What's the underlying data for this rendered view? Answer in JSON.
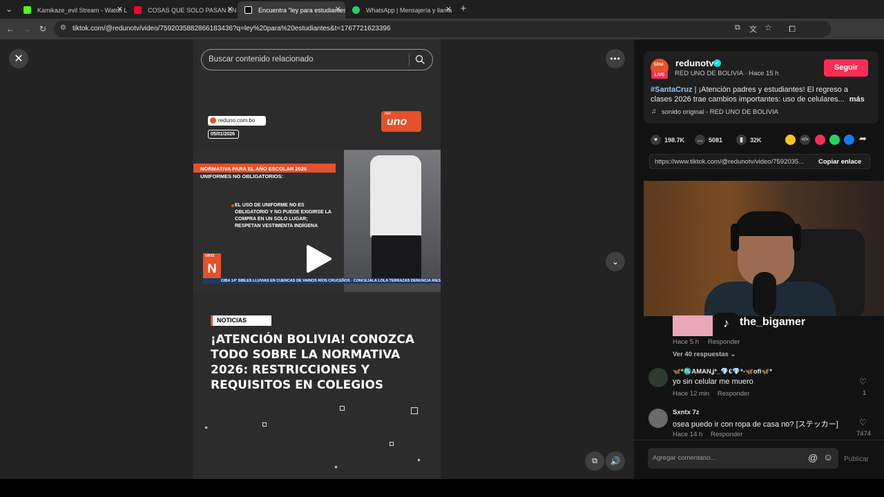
{
  "browser": {
    "tabs": [
      {
        "label": "Kamikaze_evil Stream - Watch L",
        "fav_color": "#53fc18"
      },
      {
        "label": "COSAS QUE SOLO PASAN EN B",
        "fav_color": "#ff0033"
      },
      {
        "label": "Encuentra \"ley para estudiantes",
        "fav_color": "#ffffff"
      },
      {
        "label": "WhatsApp | Mensajería y llama",
        "fav_color": "#25d366"
      }
    ],
    "url": "tiktok.com/@redunotv/video/7592035882866183436?q=ley%20para%20estudiantes&t=1767721623396"
  },
  "search": {
    "placeholder": "Buscar contenido relacionado"
  },
  "video": {
    "source_site": "reduno.com.bo",
    "date": "05/01/2026",
    "channel_logo": "uno",
    "channel_logo_small": "red",
    "tv_banner": "NORMATIVA PARA EL AÑO ESCOLAR 2026",
    "tv_sub": "UNIFORMES NO OBLIGATORIOS:",
    "tv_body": "EL USO DE UNIFORME NO ES OBLIGATORIO Y NO PUEDE EXIGIRSE LA COMPRA EN UN SOLO LUGAR; RESPETAN VESTIMENTA INDÍGENA",
    "tv_live": "VIVO",
    "tv_ticker": "CIBA 14°   SIBLES LLUVIAS EN CUENCAS DE VARIOS RÍOS CRUCEÑOS   ·   CONCEJALA LOLA TERRAZAS DENUNCIA RIESGO DE ADJUDICA",
    "badge": "NOTICIAS",
    "headline": "¡ATENCIÓN BOLIVIA! CONOZCA TODO SOBRE LA NORMATIVA 2026: RESTRICCIONES Y REQUISITOS EN COLEGIOS"
  },
  "author": {
    "name": "redunotv",
    "subtitle": "RED UNO DE BOLIVIA · Hace 15 h",
    "avatar_badge": "LIVE",
    "avatar_logo": "Uno",
    "follow_label": "Seguir",
    "hashtag": "#SantaCruz",
    "description": " | ¡Atención padres y estudiantes! El regreso a clases 2026 trae cambios importantes: uso de celulares...",
    "more_label": "más",
    "music": "sonido original - RED UNO DE BOLIVIA"
  },
  "stats": {
    "likes": "198.7K",
    "comments": "5081",
    "saves": "32K"
  },
  "share": {
    "link": "https://www.tiktok.com/@redunotv/video/7592035...",
    "copy_label": "Copiar enlace",
    "colors": [
      "#f5c518",
      "#3a3a3a",
      "#fe2c55",
      "#25d366",
      "#1877f2"
    ]
  },
  "overlay": {
    "streamer_name": "the_bigamer"
  },
  "comments": {
    "prev_meta_time": "Hace 5 h",
    "prev_reply_label": "Responder",
    "view_replies": "Ver 40 respuestas",
    "items": [
      {
        "name": "🦋*♏️AMANʝ*_💎€💎*-🦋ofi🦋*",
        "text": "yo sin celular me muero",
        "time": "Hace 12 min",
        "reply": "Responder",
        "likes": "1"
      },
      {
        "name": "Sxntx 7z",
        "text": "osea puedo ir con ropa de casa no? [ステッカー]",
        "time": "Hace 14 h",
        "reply": "Responder",
        "likes": "7474"
      }
    ],
    "placeholder": "Agregar comentario...",
    "publish_label": "Publicar"
  }
}
